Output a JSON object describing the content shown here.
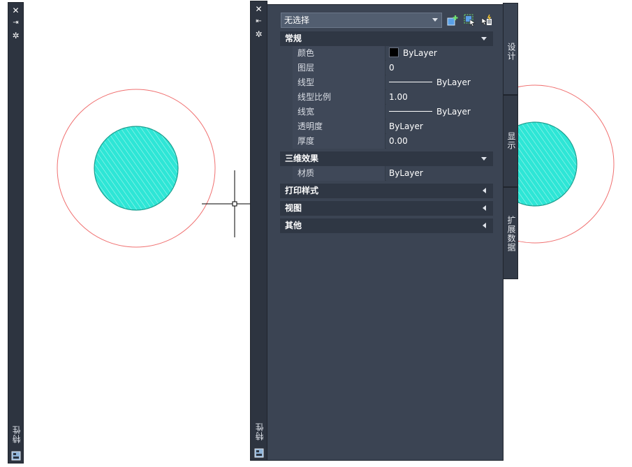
{
  "palette_title": "特性",
  "selection": "无选择",
  "tabs": [
    "设计",
    "显示",
    "扩展数据"
  ],
  "sections": {
    "general": {
      "title": "常规",
      "rows": [
        {
          "name": "颜色",
          "value": "ByLayer"
        },
        {
          "name": "图层",
          "value": "0"
        },
        {
          "name": "线型",
          "value": "ByLayer"
        },
        {
          "name": "线型比例",
          "value": "1.00"
        },
        {
          "name": "线宽",
          "value": "ByLayer"
        },
        {
          "name": "透明度",
          "value": "ByLayer"
        },
        {
          "name": "厚度",
          "value": "0.00"
        }
      ]
    },
    "3d": {
      "title": "三维效果",
      "rows": [
        {
          "name": "材质",
          "value": "ByLayer"
        }
      ]
    },
    "plot_style": {
      "title": "打印样式"
    },
    "view": {
      "title": "视图"
    },
    "misc": {
      "title": "其他"
    }
  },
  "icons": [
    "close-icon",
    "auto-hide-icon",
    "properties-menu-icon",
    "toggle-pickadd-icon",
    "select-objects-icon",
    "quick-select-icon",
    "palette-icon"
  ],
  "colors": {
    "circle_outline": "#f07070",
    "hatch_fill": "#2ee6d6",
    "hatch_edge": "#1a9e8e",
    "panel_bg": "#3b4453",
    "section_bg": "#2f3744"
  }
}
